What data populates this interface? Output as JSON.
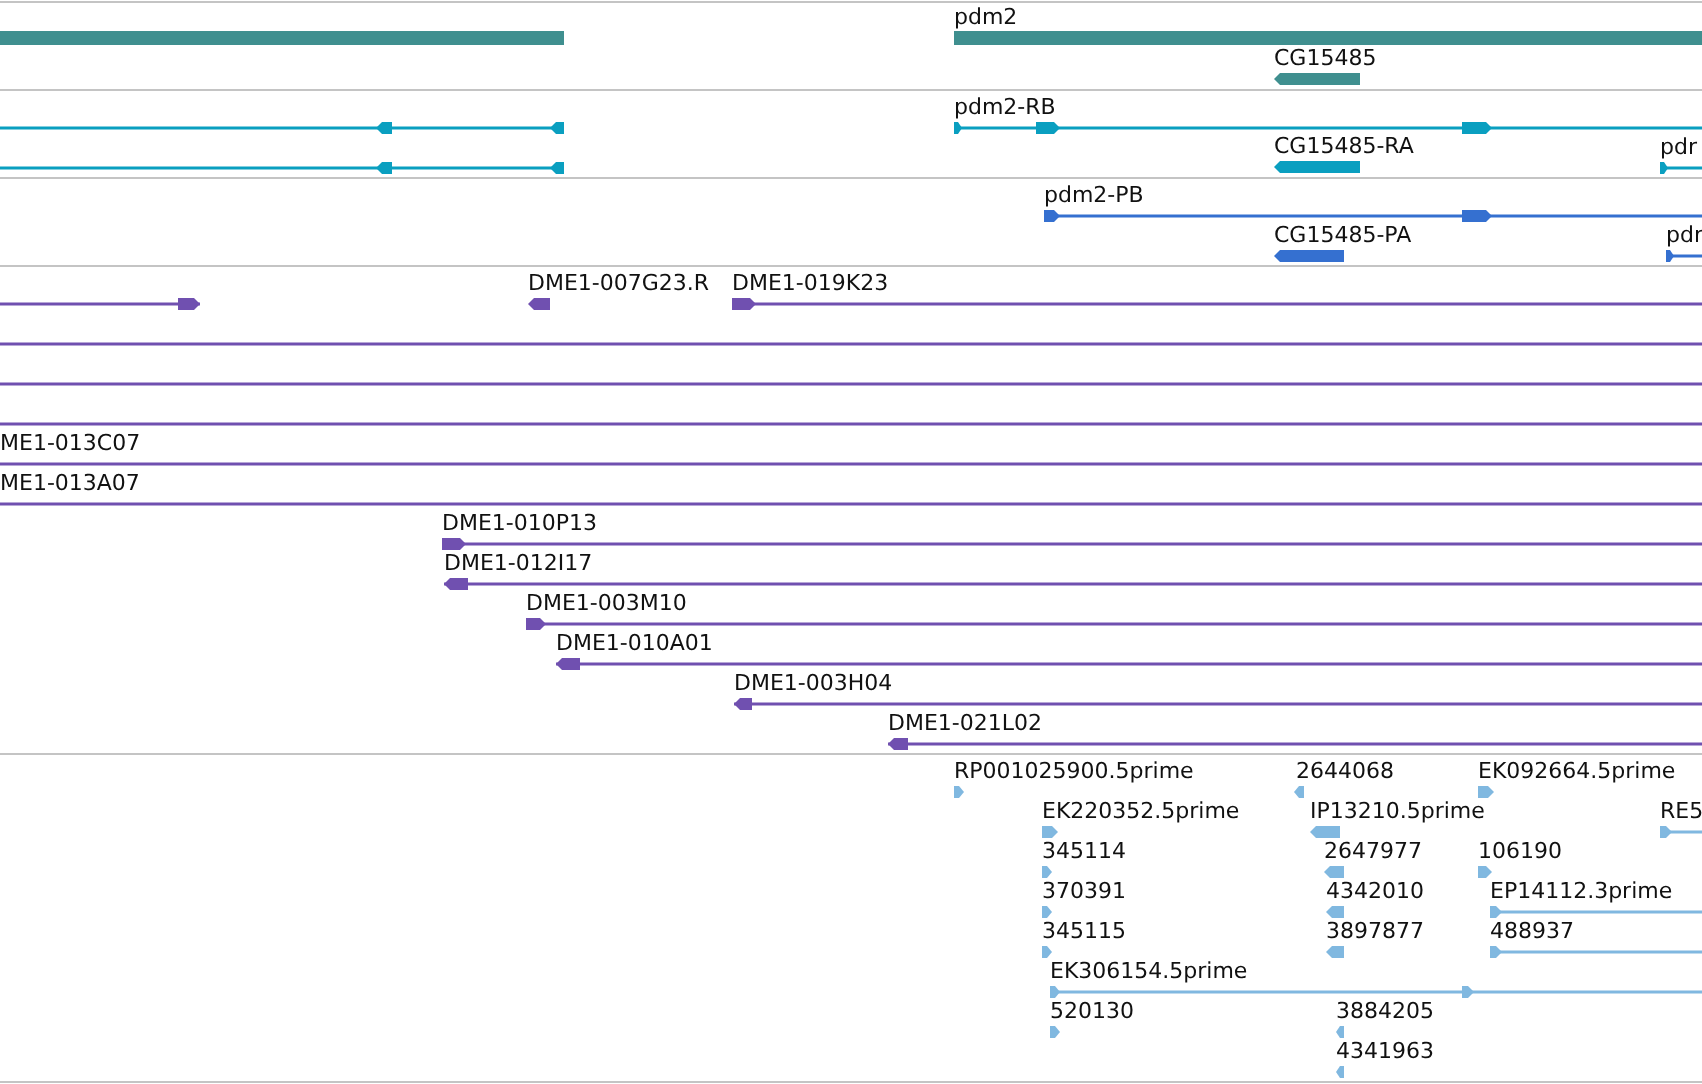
{
  "tracks": [
    {
      "color": "#3f8f8f",
      "features": [
        {
          "kind": "span"
        },
        {
          "kind": "span",
          "label": "pdm2"
        },
        {
          "kind": "gene",
          "label": "CG15485",
          "reverse": true
        }
      ]
    },
    {
      "color": "#0a9fc0",
      "features": [
        {
          "kind": "transcript",
          "reverse": true
        },
        {
          "kind": "transcript",
          "label": "pdm2-RB",
          "reverse": false
        },
        {
          "kind": "transcript",
          "reverse": true
        },
        {
          "kind": "gene",
          "label": "CG15485-RA",
          "reverse": true
        },
        {
          "kind": "transcript",
          "label": "pdr",
          "reverse": false
        }
      ]
    },
    {
      "color": "#3570d0",
      "features": [
        {
          "kind": "transcript",
          "label": "pdm2-PB",
          "reverse": false
        },
        {
          "kind": "gene",
          "label": "CG15485-PA",
          "reverse": true
        },
        {
          "kind": "transcript",
          "label": "pdr",
          "reverse": false
        }
      ]
    },
    {
      "color": "#7050b0",
      "features": [
        {
          "kind": "transcript",
          "reverse": false
        },
        {
          "kind": "gene",
          "label": "DME1-007G23.R",
          "reverse": true
        },
        {
          "kind": "transcript",
          "label": "DME1-019K23",
          "reverse": false
        },
        {
          "kind": "line"
        },
        {
          "kind": "line"
        },
        {
          "kind": "line"
        },
        {
          "kind": "line",
          "label": "ME1-013C07"
        },
        {
          "kind": "line",
          "label": "ME1-013A07"
        },
        {
          "kind": "transcript",
          "label": "DME1-010P13",
          "reverse": false
        },
        {
          "kind": "transcript",
          "label": "DME1-012I17",
          "reverse": true
        },
        {
          "kind": "transcript",
          "label": "DME1-003M10",
          "reverse": false
        },
        {
          "kind": "transcript",
          "label": "DME1-010A01",
          "reverse": true
        },
        {
          "kind": "transcript",
          "label": "DME1-003H04",
          "reverse": true
        },
        {
          "kind": "transcript",
          "label": "DME1-021L02",
          "reverse": true
        }
      ]
    },
    {
      "color": "#80b8e0",
      "features": [
        {
          "kind": "gene",
          "label": "RP001025900.5prime",
          "reverse": false
        },
        {
          "kind": "gene",
          "label": "2644068",
          "reverse": true
        },
        {
          "kind": "gene",
          "label": "EK092664.5prime",
          "reverse": false
        },
        {
          "kind": "gene",
          "label": "EK220352.5prime",
          "reverse": false
        },
        {
          "kind": "gene",
          "label": "IP13210.5prime",
          "reverse": true
        },
        {
          "kind": "transcript",
          "label": "RE5",
          "reverse": false
        },
        {
          "kind": "gene",
          "label": "345114",
          "reverse": false
        },
        {
          "kind": "gene",
          "label": "2647977",
          "reverse": true
        },
        {
          "kind": "gene",
          "label": "106190",
          "reverse": false
        },
        {
          "kind": "gene",
          "label": "370391",
          "reverse": false
        },
        {
          "kind": "gene",
          "label": "4342010",
          "reverse": true
        },
        {
          "kind": "transcript",
          "label": "EP14112.3prime",
          "reverse": false
        },
        {
          "kind": "gene",
          "label": "345115",
          "reverse": false
        },
        {
          "kind": "gene",
          "label": "3897877",
          "reverse": true
        },
        {
          "kind": "transcript",
          "label": "488937",
          "reverse": false
        },
        {
          "kind": "transcript",
          "label": "EK306154.5prime",
          "reverse": false
        },
        {
          "kind": "gene",
          "label": "520130",
          "reverse": false
        },
        {
          "kind": "gene",
          "label": "3884205",
          "reverse": true
        },
        {
          "kind": "gene",
          "label": "4341963",
          "reverse": true
        }
      ]
    }
  ]
}
